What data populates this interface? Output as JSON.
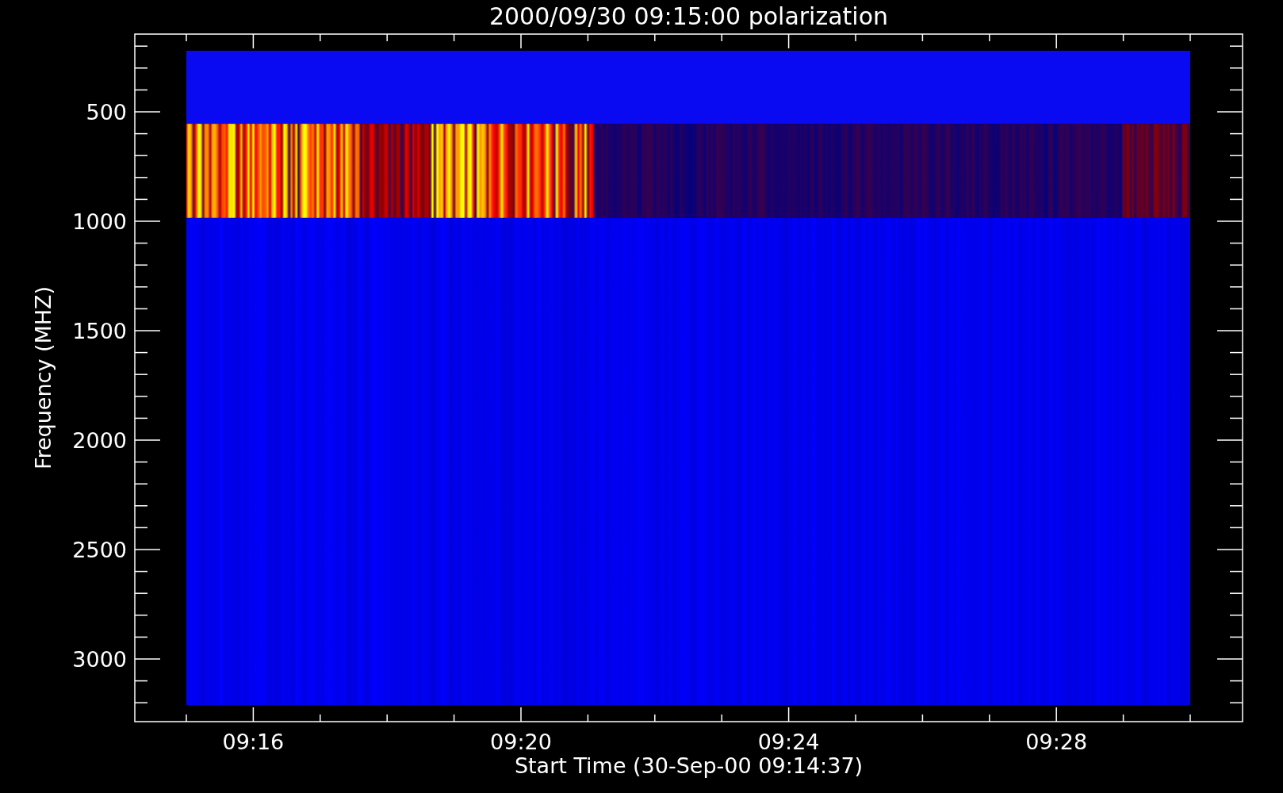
{
  "title": "2000/09/30 09:15:00 polarization",
  "plot": {
    "ylabel": "Frequency (MHZ)",
    "xlabel": "Start Time (30-Sep-00 09:14:37)",
    "yticks": [
      "500",
      "1000",
      "1500",
      "2000",
      "2500",
      "3000"
    ],
    "xticks": [
      "09:16",
      "09:20",
      "09:24",
      "09:28"
    ]
  }
}
